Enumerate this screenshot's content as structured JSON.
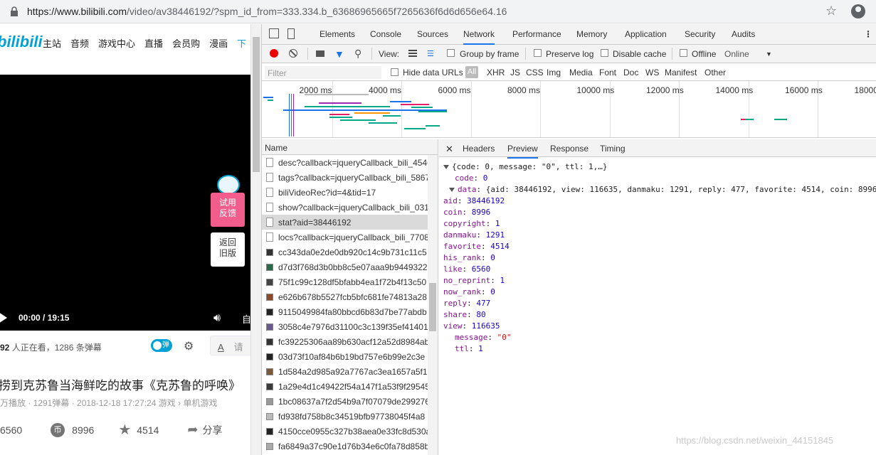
{
  "browser": {
    "url_main": "https://www.bilibili.com",
    "url_rest": "/video/av38446192/?spm_id_from=333.334.b_63686965665f7265636f6d6d656e64.16"
  },
  "bili": {
    "logo": "bilibili",
    "nav": [
      "主站",
      "音频",
      "游戏中心",
      "直播",
      "会员购",
      "漫画",
      "下"
    ],
    "player": {
      "time": "00:00",
      "sep": "/",
      "duration": "19:15",
      "feedback": "试用反馈",
      "return_old": "返回旧版",
      "full_label": "自"
    },
    "watching_count": "92",
    "watching_text": " 人正在看，1286 条弹幕",
    "danmaku_toggle": "弹",
    "danmaku_input_a": "A",
    "danmaku_input_ph": "请",
    "title": "捞到克苏鲁当海鲜吃的故事《克苏鲁的呼唤》",
    "meta": "万播放 · 1291弹幕 · 2018-12-18 17:27:24    游戏 › 单机游戏",
    "likes": "6560",
    "coins": "8996",
    "favorites": "4514",
    "share": "分享",
    "coin_glyph": "币"
  },
  "devtools": {
    "tabs": [
      "Elements",
      "Console",
      "Sources",
      "Network",
      "Performance",
      "Memory",
      "Application",
      "Security",
      "Audits"
    ],
    "active_tab": "Network",
    "toolbar": {
      "view": "View:",
      "group_by_frame": "Group by frame",
      "preserve_log": "Preserve log",
      "disable_cache": "Disable cache",
      "offline": "Offline",
      "online": "Online"
    },
    "filter": {
      "placeholder": "Filter",
      "hide_data_urls": "Hide data URLs",
      "all": "All",
      "types": [
        "XHR",
        "JS",
        "CSS",
        "Img",
        "Media",
        "Font",
        "Doc",
        "WS",
        "Manifest",
        "Other"
      ]
    },
    "timeline_labels": [
      "2000 ms",
      "4000 ms",
      "6000 ms",
      "8000 ms",
      "10000 ms",
      "12000 ms",
      "14000 ms",
      "16000 ms",
      "18000 ms"
    ],
    "name_header": "Name",
    "requests": [
      {
        "name": "desc?callback=jqueryCallback_bili_4546",
        "kind": "doc"
      },
      {
        "name": "tags?callback=jqueryCallback_bili_5867",
        "kind": "doc"
      },
      {
        "name": "biliVideoRec?id=4&tid=17",
        "kind": "doc"
      },
      {
        "name": "show?callback=jqueryCallback_bili_031",
        "kind": "doc"
      },
      {
        "name": "stat?aid=38446192",
        "kind": "doc",
        "selected": true
      },
      {
        "name": "locs?callback=jqueryCallback_bili_7708",
        "kind": "doc"
      },
      {
        "name": "cc343da0e2de0db920c14c9b731c11c5",
        "kind": "img",
        "color": "#333"
      },
      {
        "name": "d7d3f768d3b0bb8c5e07aaa9b9449322",
        "kind": "img",
        "color": "#2a6a4a"
      },
      {
        "name": "75f1c99c128df5bfabb4ea1f72b4f13c50",
        "kind": "img",
        "color": "#444"
      },
      {
        "name": "e626b678b5527fcb5bfc681fe74813a28",
        "kind": "img",
        "color": "#8a4a2a"
      },
      {
        "name": "9115049984fa80bbcd6b83d7be77abdb",
        "kind": "img",
        "color": "#222"
      },
      {
        "name": "3058c4e7976d31100c3c139f35ef41401",
        "kind": "img",
        "color": "#6a5a8a"
      },
      {
        "name": "fc39225306aa89b630acf12a52d8984ab",
        "kind": "img",
        "color": "#333"
      },
      {
        "name": "03d73f10af84b6b19bd757e6b99e2c3e",
        "kind": "img",
        "color": "#222"
      },
      {
        "name": "1d584a2d985a92a7767ac3ea1657a5f1e",
        "kind": "img",
        "color": "#7a5a3a"
      },
      {
        "name": "1a29e4d1c49422f54a147f1a53f9f29545",
        "kind": "img",
        "color": "#3a3a3a"
      },
      {
        "name": "1bc08637a7f2d54b9a7f07079de299276",
        "kind": "img",
        "color": "#999"
      },
      {
        "name": "fd938fd758b8c34519bfb97738045f4a8",
        "kind": "img",
        "color": "#bbb"
      },
      {
        "name": "4150cce0955c327b38aea0e33fc8d530a",
        "kind": "img",
        "color": "#222"
      },
      {
        "name": "fa6849a37c90e1d76b34e6c0fa78d858b",
        "kind": "img",
        "color": "#aaa"
      }
    ],
    "detail_tabs": [
      "Headers",
      "Preview",
      "Response",
      "Timing"
    ],
    "active_detail_tab": "Preview",
    "preview": {
      "summary": "{code: 0, message: \"0\", ttl: 1,…}",
      "data_summary": "{aid: 38446192, view: 116635, danmaku: 1291, reply: 477, favorite: 4514, coin: 8996",
      "code": "0",
      "fields": [
        {
          "k": "aid",
          "v": "38446192"
        },
        {
          "k": "coin",
          "v": "8996"
        },
        {
          "k": "copyright",
          "v": "1"
        },
        {
          "k": "danmaku",
          "v": "1291"
        },
        {
          "k": "favorite",
          "v": "4514"
        },
        {
          "k": "his_rank",
          "v": "0"
        },
        {
          "k": "like",
          "v": "6560"
        },
        {
          "k": "no_reprint",
          "v": "1"
        },
        {
          "k": "now_rank",
          "v": "0"
        },
        {
          "k": "reply",
          "v": "477"
        },
        {
          "k": "share",
          "v": "80"
        },
        {
          "k": "view",
          "v": "116635"
        }
      ],
      "message": "\"0\"",
      "ttl": "1"
    }
  },
  "watermark": "https://blog.csdn.net/weixin_44151845"
}
